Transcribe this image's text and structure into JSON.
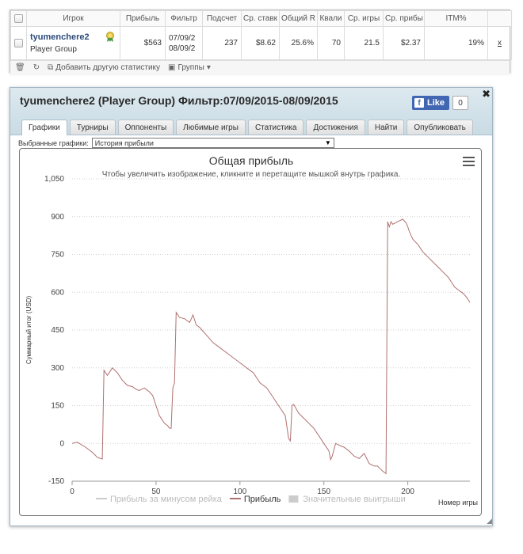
{
  "stats_table": {
    "headers": [
      "Игрок",
      "Прибыль",
      "Фильтр",
      "Подсчет",
      "Ср. ставк",
      "Общий R",
      "Квали",
      "Ср. игры",
      "Ср. прибы",
      "ITM%"
    ],
    "row": {
      "player_name": "tyumenchere2",
      "player_group": "Player Group",
      "profit": "$563",
      "filter_line1": "07/09/2",
      "filter_line2": "08/09/2",
      "count": "237",
      "avg_stake": "$8.62",
      "total_roi": "25.6%",
      "quali": "70",
      "avg_games": "21.5",
      "avg_profit": "$2.37",
      "itm": "19%",
      "remove": "x"
    },
    "toolbar": {
      "add_stats": "Добавить другую статистику",
      "groups": "Группы"
    }
  },
  "panel": {
    "title": "tyumenchere2 (Player Group) Фильтр:07/09/2015-08/09/2015",
    "fb_like": "Like",
    "fb_count": "0",
    "tabs": [
      "Графики",
      "Турниры",
      "Оппоненты",
      "Любимые игры",
      "Статистика",
      "Достижения",
      "Найти",
      "Опубликовать"
    ],
    "active_tab": 0,
    "selector_label": "Выбранные графики:",
    "selector_value": "История прибыли"
  },
  "chart_data": {
    "type": "line",
    "title": "Общая прибыль",
    "subtitle": "Чтобы увеличить изображение, кликните и перетащите мышкой внутрь графика.",
    "ylabel": "Суммарный итог (USD)",
    "xlabel": "Номер игры",
    "ylim": [
      -150,
      1050
    ],
    "xlim": [
      0,
      237
    ],
    "y_ticks": [
      "1,050",
      "900",
      "750",
      "600",
      "450",
      "300",
      "150",
      "0",
      "-150"
    ],
    "y_tick_values": [
      1050,
      900,
      750,
      600,
      450,
      300,
      150,
      0,
      -150
    ],
    "x_ticks": [
      "0",
      "50",
      "100",
      "150",
      "200"
    ],
    "x_tick_values": [
      0,
      50,
      100,
      150,
      200
    ],
    "grid": "horizontal dotted",
    "legend_position": "bottom",
    "legend": [
      {
        "name": "Прибыль за минусом рейка",
        "color": "#cccccc",
        "symbol": "line"
      },
      {
        "name": "Прибыль",
        "color": "#b07070",
        "symbol": "line"
      },
      {
        "name": "Значительные выигрыши",
        "color": "#cccccc",
        "symbol": "box"
      }
    ],
    "series": [
      {
        "name": "Прибыль",
        "color": "#b07070",
        "x": [
          0,
          3,
          8,
          12,
          15,
          17,
          18,
          19,
          21,
          24,
          27,
          30,
          33,
          36,
          38,
          40,
          43,
          46,
          48,
          50,
          52,
          55,
          57,
          58,
          59,
          60,
          61,
          62,
          63,
          64,
          67,
          70,
          72,
          74,
          76,
          80,
          84,
          88,
          92,
          96,
          100,
          104,
          108,
          112,
          116,
          120,
          123,
          125,
          127,
          129,
          130,
          131,
          132,
          135,
          138,
          141,
          144,
          147,
          150,
          153,
          154,
          155,
          157,
          160,
          162,
          165,
          168,
          171,
          174,
          177,
          180,
          182,
          185,
          187,
          188,
          189,
          190,
          191,
          194,
          197,
          199,
          200,
          201,
          203,
          206,
          209,
          212,
          215,
          218,
          221,
          224,
          226,
          228,
          230,
          233,
          235,
          237
        ],
        "y": [
          0,
          5,
          -15,
          -35,
          -55,
          -60,
          -62,
          290,
          270,
          300,
          280,
          250,
          230,
          225,
          215,
          210,
          220,
          205,
          190,
          150,
          110,
          80,
          70,
          60,
          60,
          220,
          240,
          520,
          510,
          500,
          495,
          480,
          510,
          470,
          460,
          430,
          400,
          380,
          360,
          340,
          320,
          300,
          280,
          240,
          220,
          180,
          150,
          130,
          110,
          20,
          10,
          150,
          155,
          120,
          100,
          80,
          60,
          30,
          0,
          -30,
          -65,
          -50,
          0,
          -10,
          -15,
          -30,
          -50,
          -60,
          -40,
          -80,
          -90,
          -90,
          -110,
          -120,
          880,
          860,
          880,
          870,
          880,
          890,
          875,
          860,
          840,
          810,
          790,
          760,
          740,
          720,
          700,
          680,
          660,
          640,
          620,
          610,
          595,
          580,
          560
        ]
      }
    ]
  }
}
